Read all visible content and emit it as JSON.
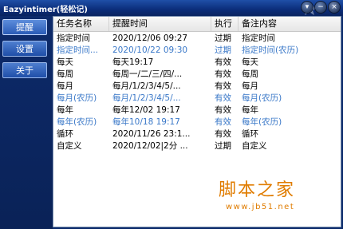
{
  "window": {
    "title": "Eazyintimer(轻松记)"
  },
  "window_buttons": {
    "menu": "▾",
    "minimize": "−",
    "close": "×"
  },
  "sidebar": {
    "items": [
      {
        "label": "提醒",
        "active": true
      },
      {
        "label": "设置",
        "active": false
      },
      {
        "label": "关于",
        "active": false
      }
    ]
  },
  "table": {
    "columns": [
      "任务名称",
      "提醒时间",
      "执行",
      "备注内容"
    ],
    "rows": [
      {
        "name": "指定时间",
        "time": "2020/12/06 09:27",
        "status": "过期",
        "note": "指定时间",
        "color": "black"
      },
      {
        "name": "指定时间...",
        "time": "2020/10/22 09:30",
        "status": "过期",
        "note": "指定时间(农历)",
        "color": "blue"
      },
      {
        "name": "每天",
        "time": "每天19:17",
        "status": "有效",
        "note": "每天",
        "color": "black"
      },
      {
        "name": "每周",
        "time": "每周一/二/三/四/...",
        "status": "有效",
        "note": "每周",
        "color": "black"
      },
      {
        "name": "每月",
        "time": "每月/1/2/3/4/5/...",
        "status": "有效",
        "note": "每月",
        "color": "black"
      },
      {
        "name": "每月(农历)",
        "time": "每月/1/2/3/4/5/...",
        "status": "有效",
        "note": "每月(农历)",
        "color": "blue"
      },
      {
        "name": "每年",
        "time": "每年12/02 19:17",
        "status": "有效",
        "note": "每年",
        "color": "black"
      },
      {
        "name": "每年(农历)",
        "time": "每年10/18 19:17",
        "status": "有效",
        "note": "每年(农历)",
        "color": "blue"
      },
      {
        "name": "循环",
        "time": "2020/11/26 23:1...",
        "status": "有效",
        "note": "循环",
        "color": "black"
      },
      {
        "name": "自定义",
        "time": "2020/12/02|2分 ...",
        "status": "过期",
        "note": "自定义",
        "color": "black"
      }
    ]
  },
  "watermark": {
    "text": "脚本之家",
    "url": "www.jb51.net"
  },
  "colors": {
    "title_bar": "#0b2d7a",
    "sidebar": "#0a2257",
    "button": "#2a5bb6",
    "lunar_text": "#3a78c8",
    "watermark": "#e07c00"
  }
}
